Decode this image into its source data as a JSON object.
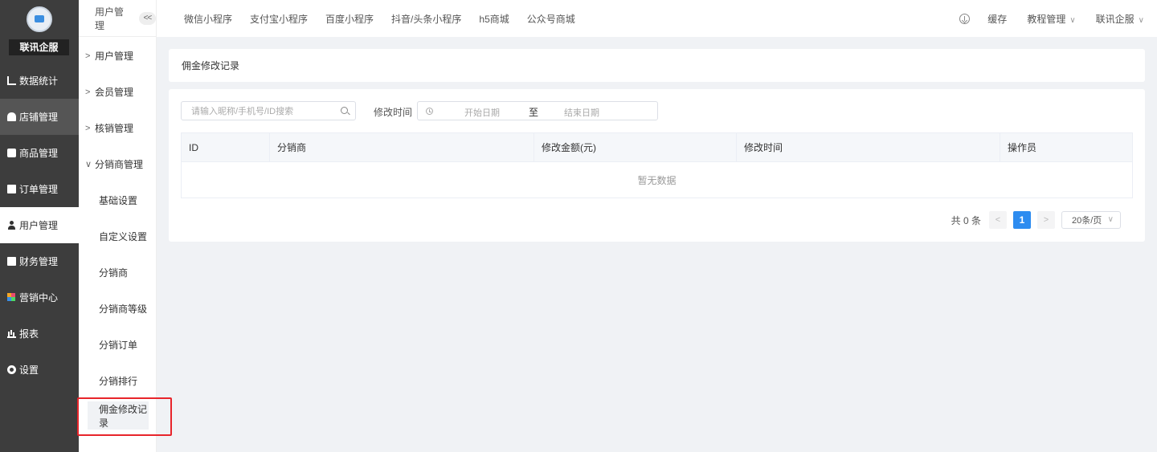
{
  "brand": {
    "name": "联讯企服"
  },
  "sidebar": {
    "items": [
      {
        "label": "数据统计",
        "icon": "chart-line-icon"
      },
      {
        "label": "店铺管理",
        "icon": "shop-icon"
      },
      {
        "label": "商品管理",
        "icon": "goods-icon"
      },
      {
        "label": "订单管理",
        "icon": "order-icon"
      },
      {
        "label": "用户管理",
        "icon": "user-icon"
      },
      {
        "label": "财务管理",
        "icon": "finance-icon"
      },
      {
        "label": "营销中心",
        "icon": "marketing-icon"
      },
      {
        "label": "报表",
        "icon": "report-icon"
      },
      {
        "label": "设置",
        "icon": "gear-icon"
      }
    ]
  },
  "subnav": {
    "header": "用户管理",
    "collapse_label": "<<",
    "groups": [
      {
        "label": "用户管理",
        "arrow": ">"
      },
      {
        "label": "会员管理",
        "arrow": ">"
      },
      {
        "label": "核销管理",
        "arrow": ">"
      },
      {
        "label": "分销商管理",
        "arrow": "∨"
      }
    ],
    "children": [
      {
        "label": "基础设置"
      },
      {
        "label": "自定义设置"
      },
      {
        "label": "分销商"
      },
      {
        "label": "分销商等级"
      },
      {
        "label": "分销订单"
      },
      {
        "label": "分销排行"
      },
      {
        "label": "佣金修改记录"
      }
    ]
  },
  "topbar": {
    "tabs": [
      {
        "label": "微信小程序"
      },
      {
        "label": "支付宝小程序"
      },
      {
        "label": "百度小程序"
      },
      {
        "label": "抖音/头条小程序"
      },
      {
        "label": "h5商城"
      },
      {
        "label": "公众号商城"
      }
    ],
    "cache_label": "缓存",
    "tutorial_label": "教程管理",
    "user_label": "联讯企服"
  },
  "page": {
    "title": "佣金修改记录",
    "search_placeholder": "请输入昵称/手机号/ID搜索",
    "date_label": "修改时间",
    "date_start_placeholder": "开始日期",
    "date_sep": "至",
    "date_end_placeholder": "结束日期"
  },
  "table": {
    "columns": [
      "ID",
      "分销商",
      "修改金额(元)",
      "修改时间",
      "操作员"
    ],
    "empty_text": "暂无数据"
  },
  "pagination": {
    "total_text": "共 0 条",
    "prev": "<",
    "current": "1",
    "next": ">",
    "page_size": "20条/页"
  },
  "colors": {
    "sidebar_bg": "#3d3d3d",
    "accent": "#2d8cf0",
    "highlight_box": "#e8252b"
  }
}
